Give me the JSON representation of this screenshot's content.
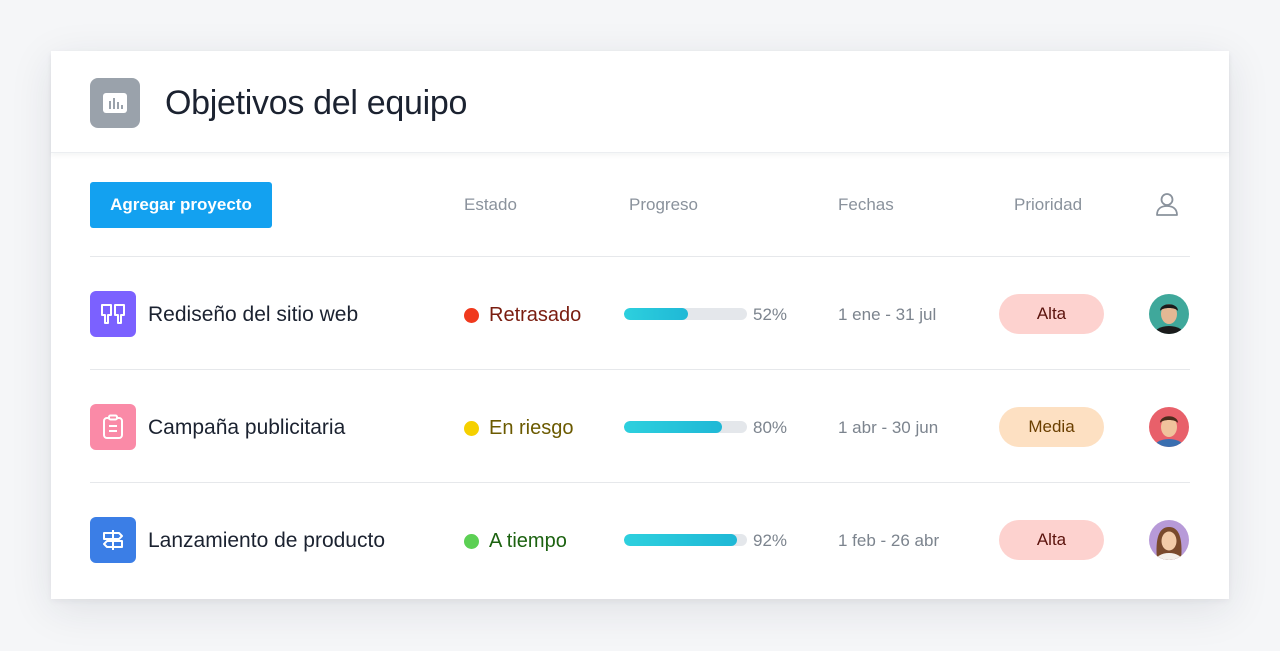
{
  "header": {
    "title": "Objetivos del equipo",
    "icon": "bar-chart-icon"
  },
  "toolbar": {
    "add_label": "Agregar proyecto"
  },
  "columns": {
    "status": "Estado",
    "progress": "Progreso",
    "dates": "Fechas",
    "priority": "Prioridad",
    "owner_icon": "user-icon"
  },
  "projects": [
    {
      "name": "Rediseño del sitio web",
      "icon": "book-open-icon",
      "icon_color": "#7b61ff",
      "status": "Retrasado",
      "status_color": "#f0391d",
      "status_text_color": "#7a1d10",
      "progress": 52,
      "progress_label": "52%",
      "dates": "1 ene - 31 jul",
      "priority": "Alta",
      "priority_bg": "#fdd2cf",
      "priority_color": "#5a120c"
    },
    {
      "name": "Campaña publicitaria",
      "icon": "clipboard-icon",
      "icon_color": "#fa8aa7",
      "status": "En riesgo",
      "status_color": "#f5d000",
      "status_text_color": "#6b5a00",
      "progress": 80,
      "progress_label": "80%",
      "dates": "1 abr - 30 jun",
      "priority": "Media",
      "priority_bg": "#fde0c2",
      "priority_color": "#6a3f00"
    },
    {
      "name": "Lanzamiento de producto",
      "icon": "signpost-icon",
      "icon_color": "#3b7ee6",
      "status": "A tiempo",
      "status_color": "#5cd054",
      "status_text_color": "#1c6210",
      "progress": 92,
      "progress_label": "92%",
      "dates": "1 feb - 26 abr",
      "priority": "Alta",
      "priority_bg": "#fdd2cf",
      "priority_color": "#5a120c"
    }
  ]
}
